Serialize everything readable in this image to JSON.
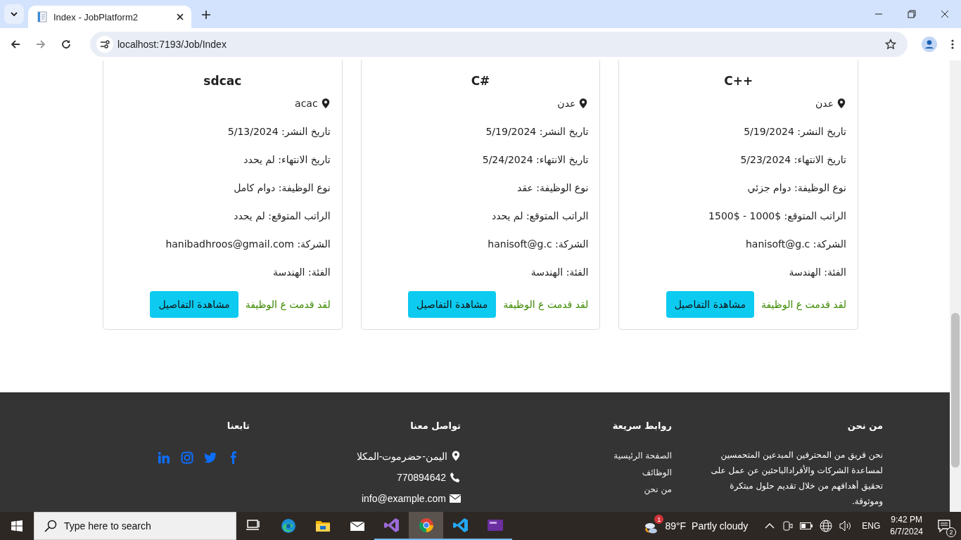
{
  "browser": {
    "tab_title": "Index - JobPlatform2",
    "url": "localhost:7193/Job/Index"
  },
  "jobs": [
    {
      "title": "C++",
      "location": "عدن",
      "details": [
        "تاريخ النشر: 5/19/2024",
        "تاريخ الانتهاء: 5/23/2024",
        "نوع الوظيفة: دوام جزئي",
        "الراتب المتوقع: $1000 - $1500",
        "الشركة: hanisoft@g.c",
        "الفئة: الهندسة"
      ],
      "applied": true,
      "status": "لقد قدمت ع الوظيفة",
      "button": "مشاهدة التفاصيل"
    },
    {
      "title": "C#",
      "location": "عدن",
      "details": [
        "تاريخ النشر: 5/19/2024",
        "تاريخ الانتهاء: 5/24/2024",
        "نوع الوظيفة: عقد",
        "الراتب المتوقع: لم يحدد",
        "الشركة: hanisoft@g.c",
        "الفئة: الهندسة"
      ],
      "applied": true,
      "status": "لقد قدمت ع الوظيفة",
      "button": "مشاهدة التفاصيل"
    },
    {
      "title": "sdcac",
      "location": "acac",
      "details": [
        "تاريخ النشر: 5/13/2024",
        "تاريخ الانتهاء: لم يحدد",
        "نوع الوظيفة: دوام كامل",
        "الراتب المتوقع: لم يحدد",
        "الشركة: hanibadhroos@gmail.com",
        "الفئة: الهندسة"
      ],
      "applied": true,
      "status": "لقد قدمت ع الوظيفة",
      "button": "مشاهدة التفاصيل"
    }
  ],
  "footer": {
    "columns": [
      {
        "kind": "text",
        "heading": "من نحن",
        "text": "نحن فريق من المحترفين المبدعين المتحمسين لمساعدة الشركات والأفرادالباحثين عن عمل على تحقيق أهدافهم من خلال تقديم حلول مبتكرة وموثوقة."
      },
      {
        "kind": "links",
        "heading": "روابط سريعة",
        "items": [
          "الصفحة الرئيسية",
          "الوظائف",
          "من نحن"
        ]
      },
      {
        "kind": "contact",
        "heading": "تواصل معنا",
        "items": [
          {
            "kind": "location",
            "text": "اليمن-حضرموت-المكلا"
          },
          {
            "kind": "phone",
            "text": "770894642"
          },
          {
            "kind": "email",
            "text": "info@example.com"
          }
        ]
      },
      {
        "kind": "social",
        "heading": "تابعنا",
        "items": [
          {
            "kind": "facebook"
          },
          {
            "kind": "twitter"
          },
          {
            "kind": "instagram"
          },
          {
            "kind": "linkedin"
          }
        ]
      }
    ]
  },
  "taskbar": {
    "search_placeholder": "Type here to search",
    "apps": [
      {
        "kind": "taskview",
        "running": false,
        "selected": false
      },
      {
        "kind": "edge",
        "running": false,
        "selected": false
      },
      {
        "kind": "explorer",
        "running": false,
        "selected": false
      },
      {
        "kind": "mail",
        "running": false,
        "selected": false
      },
      {
        "kind": "vs",
        "running": true,
        "selected": false
      },
      {
        "kind": "chrome",
        "running": true,
        "selected": true
      },
      {
        "kind": "vscode",
        "running": true,
        "selected": false
      },
      {
        "kind": "purple",
        "running": true,
        "selected": false
      }
    ],
    "weather_badge": "1",
    "temperature": "89°F",
    "weather": "Partly cloudy",
    "language": "ENG",
    "time": "9:42 PM",
    "date": "6/7/2024",
    "notifications": "2"
  }
}
